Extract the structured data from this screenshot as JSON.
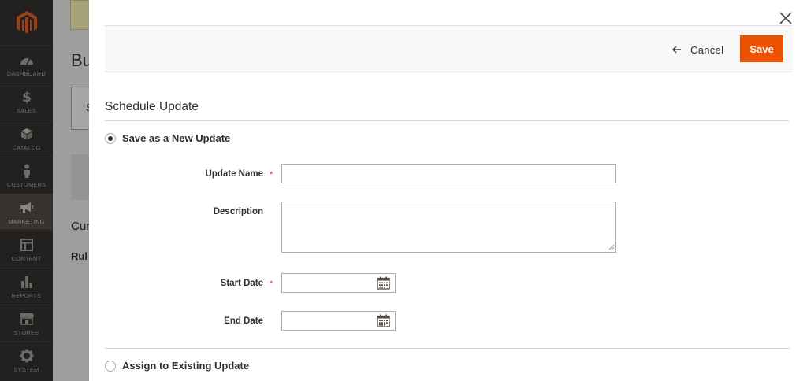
{
  "sidebar": {
    "items": [
      {
        "label": "DASHBOARD",
        "icon": "dashboard-icon"
      },
      {
        "label": "SALES",
        "icon": "dollar-icon"
      },
      {
        "label": "CATALOG",
        "icon": "box-icon"
      },
      {
        "label": "CUSTOMERS",
        "icon": "person-icon"
      },
      {
        "label": "MARKETING",
        "icon": "megaphone-icon",
        "active": true
      },
      {
        "label": "CONTENT",
        "icon": "layout-icon"
      },
      {
        "label": "REPORTS",
        "icon": "bar-chart-icon"
      },
      {
        "label": "STORES",
        "icon": "storefront-icon"
      },
      {
        "label": "SYSTEM",
        "icon": "gear-icon"
      }
    ]
  },
  "background_page": {
    "title": "Bu",
    "box_text": "S",
    "section": "Cur",
    "rule": "Rul"
  },
  "modal": {
    "actions": {
      "cancel_label": "Cancel",
      "save_label": "Save"
    },
    "section_title": "Schedule Update",
    "options": {
      "new_update_label": "Save as a New Update",
      "new_update_checked": true,
      "existing_update_label": "Assign to Existing Update",
      "existing_update_checked": false
    },
    "fields": {
      "update_name": {
        "label": "Update Name",
        "required": true,
        "value": ""
      },
      "description": {
        "label": "Description",
        "required": false,
        "value": ""
      },
      "start_date": {
        "label": "Start Date",
        "required": true,
        "value": ""
      },
      "end_date": {
        "label": "End Date",
        "required": false,
        "value": ""
      }
    },
    "required_marker": "*"
  },
  "colors": {
    "sidebar_bg": "#373330",
    "accent": "#eb5202",
    "required": "#e22626"
  }
}
